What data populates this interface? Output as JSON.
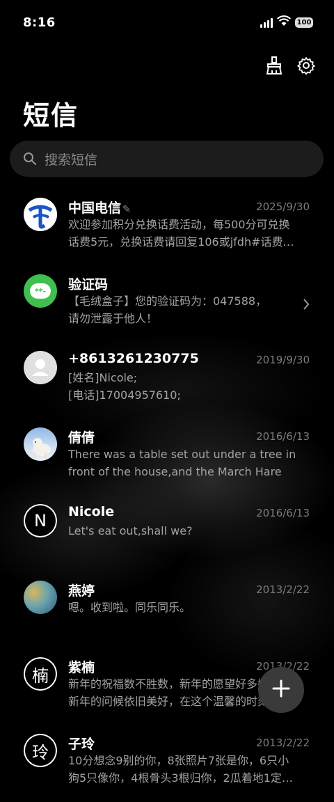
{
  "status_bar": {
    "time": "8:16",
    "battery": "100"
  },
  "header": {
    "title": "短信",
    "clean_icon": "broom-icon",
    "settings_icon": "gear-icon"
  },
  "search": {
    "placeholder": "搜索短信"
  },
  "messages": [
    {
      "name": "中国电信",
      "date": "2025/9/30",
      "preview": "欢迎参加积分兑换话费活动，每500分可兑换\n话费5元，兑换话费请回复106或jfdh#话费…",
      "avatar": "china-telecom-logo",
      "edit_mark": "✎"
    },
    {
      "name": "验证码",
      "date": "",
      "preview": "【毛绒盒子】您的验证码为：047588，\n请勿泄露于他人！",
      "avatar": "green-message-icon",
      "badge": "**-"
    },
    {
      "name": "+8613261230775",
      "date": "2019/9/30",
      "preview": "[姓名]Nicole;\n[电话]17004957610;",
      "avatar": "default-person-icon"
    },
    {
      "name": "倩倩",
      "date": "2016/6/13",
      "preview": "There was a table set out under a tree in\nfront of the house,and the March Hare an…",
      "avatar": "polar-bear-photo"
    },
    {
      "name": "Nicole",
      "date": "2016/6/13",
      "preview": "Let's eat out,shall we?",
      "avatar": "letter-avatar",
      "letter": "N"
    },
    {
      "name": "燕婷",
      "date": "2013/2/22",
      "preview": "嗯。收到啦。同乐同乐。",
      "avatar": "painting-photo"
    },
    {
      "name": "紫楠",
      "date": "2013/2/22",
      "preview": "新年的祝福数不胜数，新年的愿望好多好多，\n新年的问候依旧美好，在这个温馨的时刻，…",
      "avatar": "letter-avatar",
      "letter": "楠"
    },
    {
      "name": "子玲",
      "date": "2013/2/22",
      "preview": "10分想念9别的你，8张照片7张是你，6只小\n狗5只像你，4根骨头3根归你，2瓜着地1定…",
      "avatar": "letter-avatar",
      "letter": "玲"
    }
  ],
  "fab": {
    "icon": "plus-icon"
  }
}
